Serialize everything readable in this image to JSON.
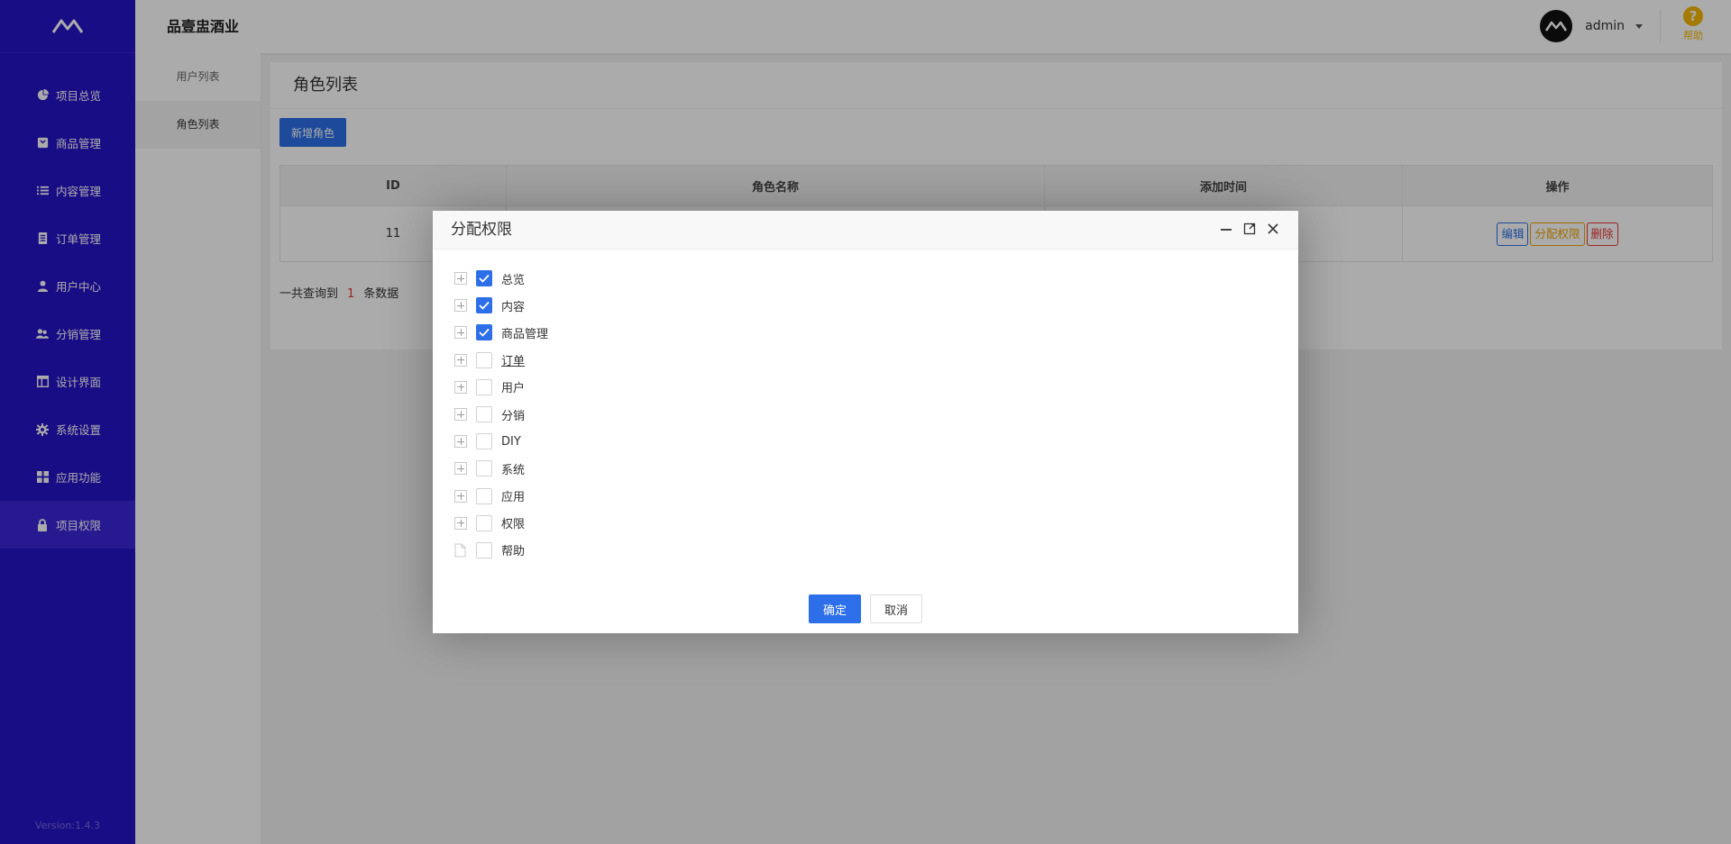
{
  "app": {
    "brand": "品壹盅酒业",
    "version": "Version:1.4.3"
  },
  "header": {
    "username": "admin",
    "help_label": "帮助",
    "help_glyph": "?"
  },
  "sidebar": {
    "items": [
      {
        "label": "项目总览",
        "icon": "pie-chart-icon"
      },
      {
        "label": "商品管理",
        "icon": "product-icon"
      },
      {
        "label": "内容管理",
        "icon": "list-icon"
      },
      {
        "label": "订单管理",
        "icon": "order-icon"
      },
      {
        "label": "用户中心",
        "icon": "user-icon"
      },
      {
        "label": "分销管理",
        "icon": "group-icon"
      },
      {
        "label": "设计界面",
        "icon": "layout-icon"
      },
      {
        "label": "系统设置",
        "icon": "gear-icon"
      },
      {
        "label": "应用功能",
        "icon": "apps-icon"
      },
      {
        "label": "项目权限",
        "icon": "lock-icon",
        "active": true
      }
    ]
  },
  "subnav": {
    "items": [
      {
        "label": "用户列表"
      },
      {
        "label": "角色列表",
        "active": true
      }
    ]
  },
  "main": {
    "title": "角色列表",
    "add_button": "新增角色",
    "table": {
      "headers": [
        "ID",
        "角色名称",
        "添加时间",
        "操作"
      ],
      "rows": [
        {
          "id": "11",
          "name": "",
          "time": ""
        }
      ],
      "ops": {
        "edit": "编辑",
        "assign": "分配权限",
        "delete": "删除"
      }
    },
    "summary": {
      "prefix": "一共查询到",
      "count": "1",
      "suffix": "条数据"
    }
  },
  "modal": {
    "title": "分配权限",
    "tree": [
      {
        "label": "总览",
        "checked": true,
        "expandable": true
      },
      {
        "label": "内容",
        "checked": true,
        "expandable": true
      },
      {
        "label": "商品管理",
        "checked": true,
        "expandable": true
      },
      {
        "label": "订单",
        "checked": false,
        "expandable": true,
        "underline": true
      },
      {
        "label": "用户",
        "checked": false,
        "expandable": true
      },
      {
        "label": "分销",
        "checked": false,
        "expandable": true
      },
      {
        "label": "DIY",
        "checked": false,
        "expandable": true
      },
      {
        "label": "系统",
        "checked": false,
        "expandable": true
      },
      {
        "label": "应用",
        "checked": false,
        "expandable": true
      },
      {
        "label": "权限",
        "checked": false,
        "expandable": true
      },
      {
        "label": "帮助",
        "checked": false,
        "expandable": false
      }
    ],
    "ok": "确定",
    "cancel": "取消"
  },
  "colors": {
    "sidebar": "#2614c8",
    "primary": "#2d6fe8",
    "warning": "#f0a500",
    "danger": "#ee3333",
    "help": "#f5b800"
  }
}
